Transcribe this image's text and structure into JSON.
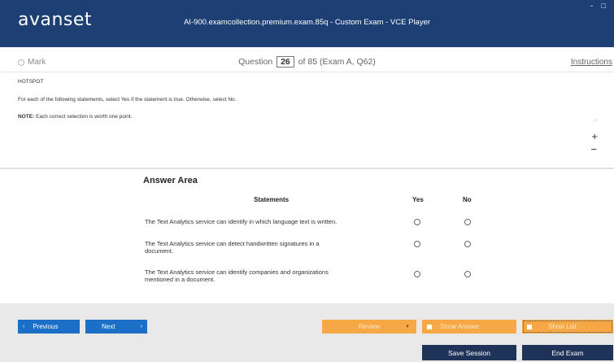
{
  "header": {
    "logo": "avanset",
    "title": "AI-900.examcollection.premium.exam.85q - Custom Exam - VCE Player",
    "controls": "- □"
  },
  "question_bar": {
    "mark_label": "Mark",
    "question_prefix": "Question",
    "question_number": "26",
    "question_suffix": "of 85 (Exam A, Q62)",
    "instructions_label": "Instructions"
  },
  "question": {
    "type": "HOTSPOT",
    "prompt": "For each of the following statements, select Yes if the statement is true. Otherwise, select No.",
    "note_label": "NOTE:",
    "note_text": " Each correct selection is worth one point."
  },
  "zoom": {
    "search_icon": "⌕",
    "plus": "+",
    "minus": "−"
  },
  "answer": {
    "title": "Answer Area",
    "col_statements": "Statements",
    "col_yes": "Yes",
    "col_no": "No",
    "rows": [
      {
        "line1": "The Text Analytics service can identify in which language text is written.",
        "line2": ""
      },
      {
        "line1": "The Text Analytics service can detect handwritten signatures in a",
        "line2": "document."
      },
      {
        "line1": "The Text Analytics service can identify companies and organizations",
        "line2": "mentioned in a document."
      }
    ]
  },
  "footer": {
    "previous": "Previous",
    "next": "Next",
    "review": "Review",
    "show_answer": "Show Answer",
    "show_list": "Show List",
    "save_session": "Save Session",
    "end_exam": "End Exam"
  }
}
